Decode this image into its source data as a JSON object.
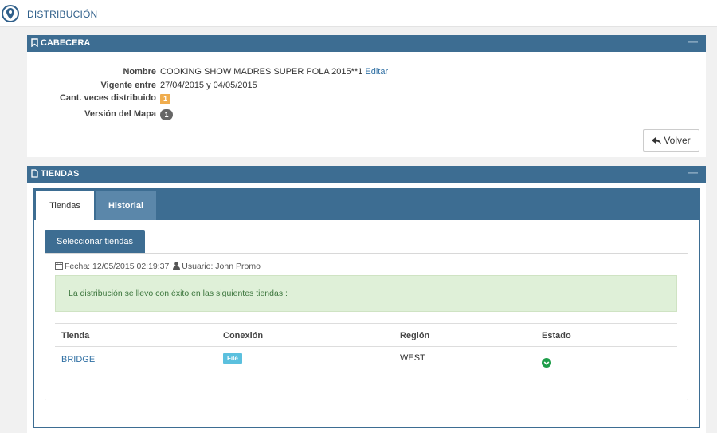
{
  "header": {
    "title": "DISTRIBUCIÓN"
  },
  "cabecera": {
    "title": "CABECERA",
    "collapse": "—",
    "fields": [
      {
        "label": "Nombre",
        "value": "COOKING SHOW MADRES SUPER POLA 2015**1",
        "link": "Editar"
      },
      {
        "label": "Vigente entre",
        "value": "27/04/2015 y 04/05/2015"
      },
      {
        "label": "Cant. veces distribuido",
        "value": "1"
      },
      {
        "label": "Versión del Mapa",
        "value": "1"
      }
    ],
    "back_button": "Volver"
  },
  "tiendas": {
    "title": "TIENDAS",
    "collapse": "—",
    "tabs": [
      {
        "label": "Tiendas",
        "active": true
      },
      {
        "label": "Historial",
        "active": false
      }
    ],
    "select_button": "Seleccionar tiendas",
    "meta": {
      "fecha": "Fecha: 12/05/2015 02:19:37",
      "usuario": "Usuario: John Promo"
    },
    "alert": "La distribución se llevo con éxito en las siguientes tiendas :",
    "columns": [
      "Tienda",
      "Conexión",
      "Región",
      "Estado"
    ],
    "rows": [
      {
        "tienda": "BRIDGE",
        "conexion": "File",
        "region": "WEST",
        "estado": "ok"
      }
    ]
  },
  "colors": {
    "primary": "#3d6d92",
    "success_bg": "#dff0d8",
    "orange": "#f0ad4e",
    "info": "#5bc0de",
    "ok_green": "#1e9e4a"
  }
}
